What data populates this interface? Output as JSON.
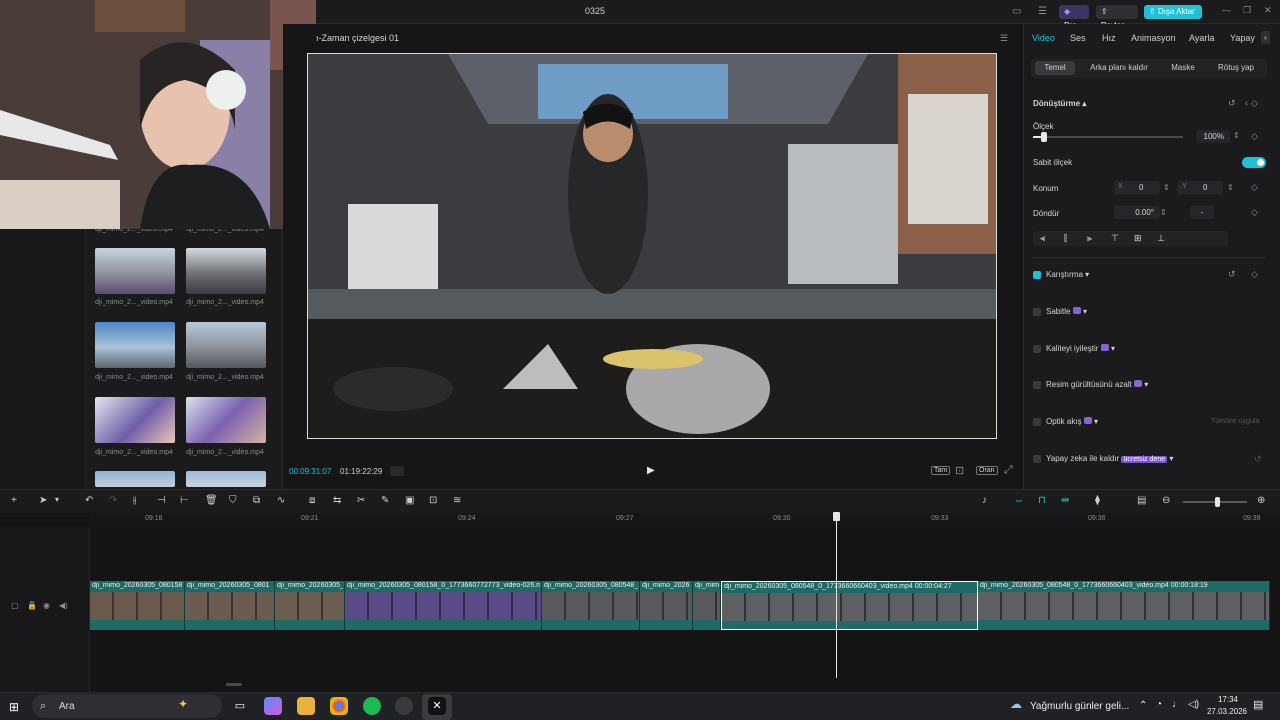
{
  "window": {
    "title": "0325"
  },
  "topbar": {
    "pro_label": "Pro",
    "share_label": "Paylaş",
    "export_label": "Dışa Aktar",
    "minimize": "—",
    "maximize": "❐",
    "close": "✕"
  },
  "media": {
    "top_labels": [
      "dji_mimo_2..._video.mp4",
      "dji_mimo_2..._video.mp4"
    ],
    "thumbs": [
      {
        "label": "dji_mimo_2..._video.mp4"
      },
      {
        "label": "dji_mimo_2..._video.mp4"
      },
      {
        "label": "dji_mimo_2..._video.mp4"
      },
      {
        "label": "dji_mimo_2..._video.mp4"
      },
      {
        "label": "dji_mimo_2..._video.mp4"
      },
      {
        "label": "dji_mimo_2..._video.mp4"
      }
    ]
  },
  "player": {
    "title": "ı-Zaman çizelgesi 01",
    "current_time": "00:09:31:07",
    "total_time": "01:19:22:29",
    "play_icon": "▶",
    "quality_label": "Tam",
    "ratio_label": "Oran"
  },
  "inspector": {
    "tabs": [
      "Video",
      "Ses",
      "Hız",
      "Animasyon",
      "Ayarla",
      "Yapay"
    ],
    "active_tab": "Video",
    "subtabs": [
      "Temel",
      "Arka planı kaldır",
      "Maske",
      "Rötuş yap"
    ],
    "transform": {
      "title": "Dönüştürme",
      "scale_label": "Ölçek",
      "scale_value": "100%",
      "scale_fraction": 0.07,
      "fixed_scale_label": "Sabit ölçek",
      "fixed_scale_on": true,
      "position_label": "Konum",
      "x_label": "X",
      "x_value": "0",
      "y_label": "Y",
      "y_value": "0",
      "rotate_label": "Döndür",
      "rotate_value": "0.00°"
    },
    "sections": [
      {
        "label": "Karıştırma",
        "checked": true
      },
      {
        "label": "Sabitle",
        "checked": false
      },
      {
        "label": "Kaliteyi iyileştir",
        "checked": false
      },
      {
        "label": "Resim gürültüsünü azalt",
        "checked": false
      },
      {
        "label": "Optik akış",
        "checked": false
      },
      {
        "label": "Yapay zeka ile kaldır",
        "checked": false
      }
    ],
    "apply_all_label": "Tümüne uygula",
    "free_badge": "ücretsiz dene"
  },
  "timeline": {
    "ruler_labels": [
      "09:18",
      "09:21",
      "09:24",
      "09:27",
      "09:30",
      "09:33",
      "09:36",
      "09:39"
    ],
    "clips": [
      {
        "label": "dji_mimo_20260305_080158_0_1"
      },
      {
        "label": "dji_mimo_20260305_0801"
      },
      {
        "label": "dji_mimo_20260305_0"
      },
      {
        "label": "dji_mimo_20260305_080158_0_1773660772773_video-026.mp4"
      },
      {
        "label": "dji_mimo_20260305_080548_0"
      },
      {
        "label": "dji_mimo_2026"
      },
      {
        "label": "dji_mim"
      },
      {
        "label": "dji_mimo_20260305_080548_0_1773660660403_video.mp4   00:00:04:27"
      },
      {
        "label": "dji_mimo_20260305_080548_0_1773660660403_video.mp4   00:00:18:19"
      }
    ]
  },
  "taskbar": {
    "search_placeholder": "Ara",
    "weather_text": "Yağmurlu günler geli...",
    "time": "17:34",
    "date": "27.03.2026"
  },
  "colors": {
    "accent": "#1fc1d4",
    "track": "#1f6a62",
    "background": "#141416"
  }
}
